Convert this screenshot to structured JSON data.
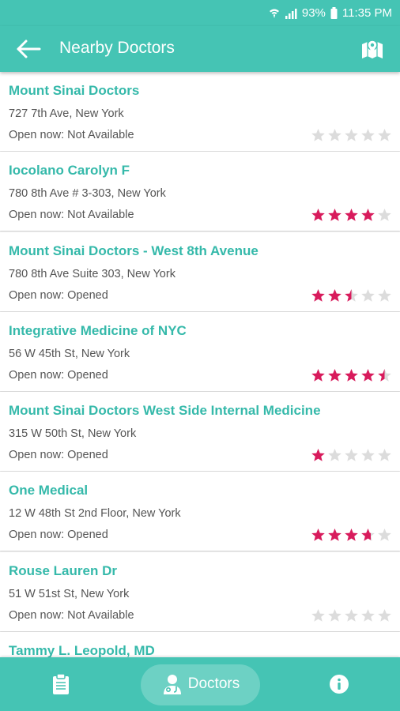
{
  "status_bar": {
    "battery": "93%",
    "time": "11:35 PM"
  },
  "header": {
    "title": "Nearby Doctors"
  },
  "doctors": [
    {
      "name": "Mount Sinai Doctors",
      "address": "727 7th Ave, New York",
      "open": "Open now: Not Available",
      "rating": 0
    },
    {
      "name": "Iocolano Carolyn F",
      "address": "780 8th Ave # 3-303, New York",
      "open": "Open now: Not Available",
      "rating": 4
    },
    {
      "name": "Mount Sinai Doctors - West 8th Avenue",
      "address": "780 8th Ave Suite 303, New York",
      "open": "Open now: Opened",
      "rating": 2.5
    },
    {
      "name": "Integrative Medicine of NYC",
      "address": "56 W 45th St, New York",
      "open": "Open now: Opened",
      "rating": 4.5
    },
    {
      "name": "Mount Sinai Doctors West Side Internal Medicine",
      "address": "315 W 50th St, New York",
      "open": "Open now: Opened",
      "rating": 1
    },
    {
      "name": "One Medical",
      "address": "12 W 48th St 2nd Floor, New York",
      "open": "Open now: Opened",
      "rating": 3.7
    },
    {
      "name": "Rouse Lauren Dr",
      "address": "51 W 51st St, New York",
      "open": "Open now: Not Available",
      "rating": 0
    },
    {
      "name": "Tammy L. Leopold, MD",
      "address": "",
      "open": "",
      "rating": 0
    }
  ],
  "bottom_nav": {
    "doctors_label": "Doctors"
  },
  "colors": {
    "primary": "#45c4b4",
    "name_text": "#35b9aa",
    "star_filled": "#d81b5c",
    "star_empty": "#dcdcdc"
  }
}
